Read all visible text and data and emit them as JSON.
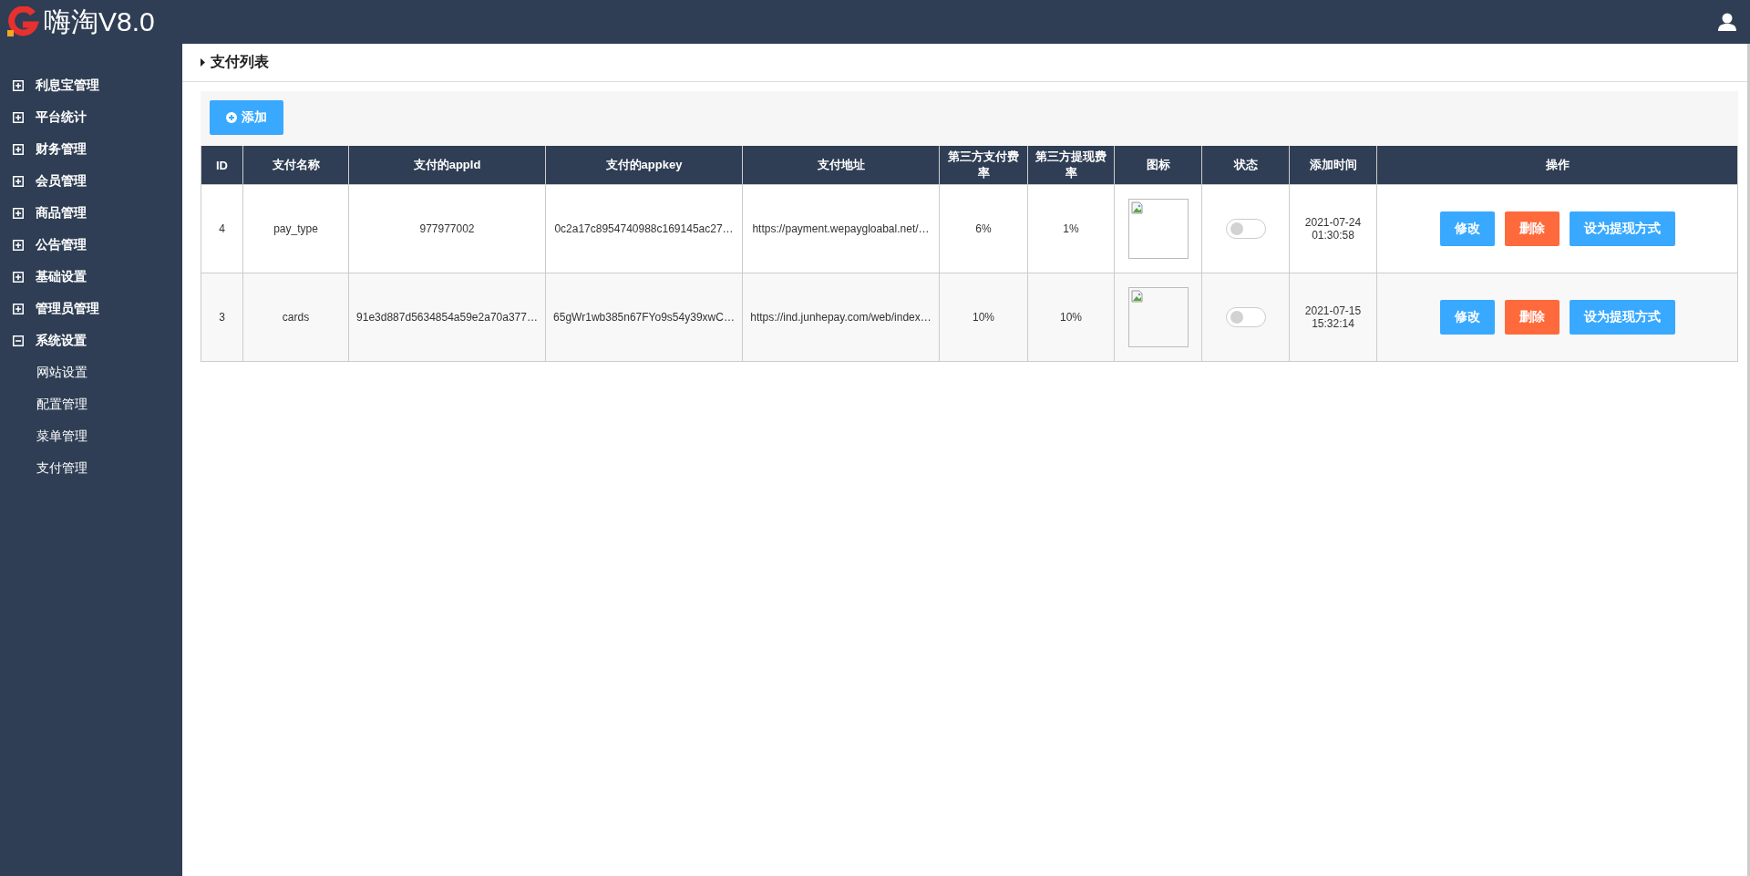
{
  "header": {
    "title": "嗨淘V8.0"
  },
  "sidebar": {
    "items": [
      {
        "label": "利息宝管理",
        "expanded": false
      },
      {
        "label": "平台统计",
        "expanded": false
      },
      {
        "label": "财务管理",
        "expanded": false
      },
      {
        "label": "会员管理",
        "expanded": false
      },
      {
        "label": "商品管理",
        "expanded": false
      },
      {
        "label": "公告管理",
        "expanded": false
      },
      {
        "label": "基础设置",
        "expanded": false
      },
      {
        "label": "管理员管理",
        "expanded": false
      },
      {
        "label": "系统设置",
        "expanded": true,
        "children": [
          {
            "label": "网站设置"
          },
          {
            "label": "配置管理"
          },
          {
            "label": "菜单管理"
          },
          {
            "label": "支付管理"
          }
        ]
      }
    ]
  },
  "page": {
    "title": "支付列表"
  },
  "toolbar": {
    "add_button": "添加"
  },
  "table": {
    "columns": [
      {
        "label": "ID"
      },
      {
        "label": "支付名称"
      },
      {
        "label": "支付的appId"
      },
      {
        "label": "支付的appkey"
      },
      {
        "label": "支付地址"
      },
      {
        "label": "第三方支付费率"
      },
      {
        "label": "第三方提现费率"
      },
      {
        "label": "图标"
      },
      {
        "label": "状态"
      },
      {
        "label": "添加时间"
      },
      {
        "label": "操作"
      }
    ],
    "rows": [
      {
        "id": "4",
        "name": "pay_type",
        "appid": "977977002",
        "appkey": "0c2a17c8954740988c169145ac27…",
        "url": "https://payment.wepaygloabal.net/…",
        "pay_rate": "6%",
        "withdraw_rate": "1%",
        "on": false,
        "date": "2021-07-24",
        "time": "01:30:58",
        "actions": [
          "修改",
          "删除",
          "设为提现方式"
        ]
      },
      {
        "id": "3",
        "name": "cards",
        "appid": "91e3d887d5634854a59e2a70a377…",
        "appkey": "65gWr1wb385n67FYo9s54y39xwC…",
        "url": "https://ind.junhepay.com/web/index…",
        "pay_rate": "10%",
        "withdraw_rate": "10%",
        "on": false,
        "date": "2021-07-15",
        "time": "15:32:14",
        "actions": [
          "修改",
          "删除",
          "设为提现方式"
        ]
      }
    ]
  }
}
